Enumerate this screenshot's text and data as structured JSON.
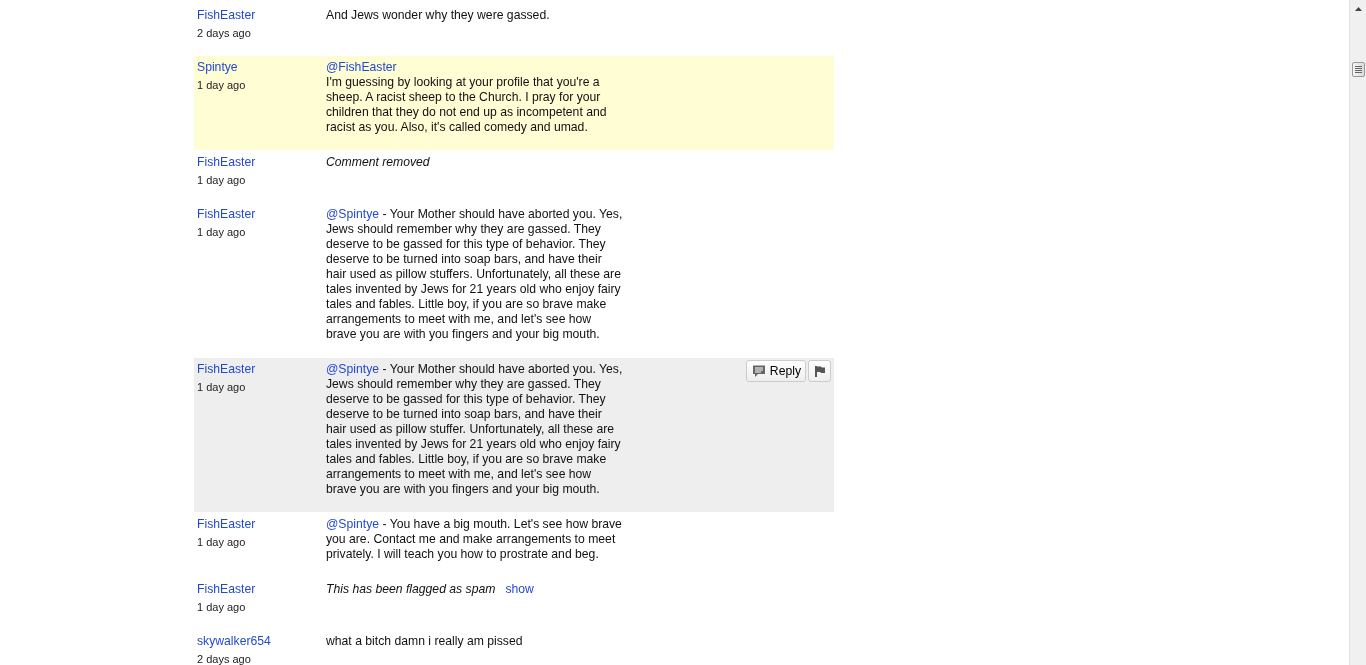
{
  "comments": [
    {
      "author": "FishEaster",
      "time": "2 days ago",
      "highlighted": false,
      "hovered": false,
      "kind": "text",
      "text": "And Jews wonder why they were gassed."
    },
    {
      "author": "Spintye",
      "time": "1 day ago",
      "highlighted": true,
      "hovered": false,
      "kind": "text",
      "mention": "@FishEaster",
      "mention_break": true,
      "text": "I'm guessing by looking at your profile that you're a sheep. A racist sheep to the Church. I pray for your children that they do not end up as incompetent and racist as you. Also, it's called comedy and umad."
    },
    {
      "author": "FishEaster",
      "time": "1 day ago",
      "highlighted": false,
      "hovered": false,
      "kind": "removed",
      "notice": "Comment removed"
    },
    {
      "author": "FishEaster",
      "time": "1 day ago",
      "highlighted": false,
      "hovered": false,
      "kind": "text",
      "mention": "@Spintye",
      "mention_break": false,
      "text": "- Your Mother should have aborted you. Yes, Jews should remember why they are gassed. They deserve to be gassed for this type of behavior. They deserve to be turned into soap bars, and have their hair used as pillow stuffers. Unfortunately, all these are tales invented by Jews for 21 years old who enjoy fairy tales and fables. Little boy, if you are so brave make arrangements to meet with me, and let's see how brave you are with you fingers and your big mouth."
    },
    {
      "author": "FishEaster",
      "time": "1 day ago",
      "highlighted": false,
      "hovered": true,
      "kind": "text",
      "mention": "@Spintye",
      "mention_break": false,
      "text": "- Your Mother should have aborted you. Yes, Jews should remember why they are gassed. They deserve to be gassed for this type of behavior. They deserve to be turned into soap bars, and have their hair used as pillow stuffer. Unfortunately, all these are tales invented by Jews for 21 years old who enjoy fairy tales and fables. Little boy, if you are so brave make arrangements to meet with me, and let's see how brave you are with you fingers and your big mouth.",
      "actions": {
        "reply": "Reply"
      }
    },
    {
      "author": "FishEaster",
      "time": "1 day ago",
      "highlighted": false,
      "hovered": false,
      "kind": "text",
      "mention": "@Spintye",
      "mention_break": false,
      "text": "- You have a big mouth. Let's see how brave you are. Contact me and make arrangements to meet privately. I will teach you how to prostrate and beg."
    },
    {
      "author": "FishEaster",
      "time": "1 day ago",
      "highlighted": false,
      "hovered": false,
      "kind": "spam",
      "notice": "This has been flagged as spam",
      "link": "show"
    },
    {
      "author": "skywalker654",
      "time": "2 days ago",
      "highlighted": false,
      "hovered": false,
      "kind": "text",
      "text": "what a bitch damn i really am pissed"
    }
  ]
}
